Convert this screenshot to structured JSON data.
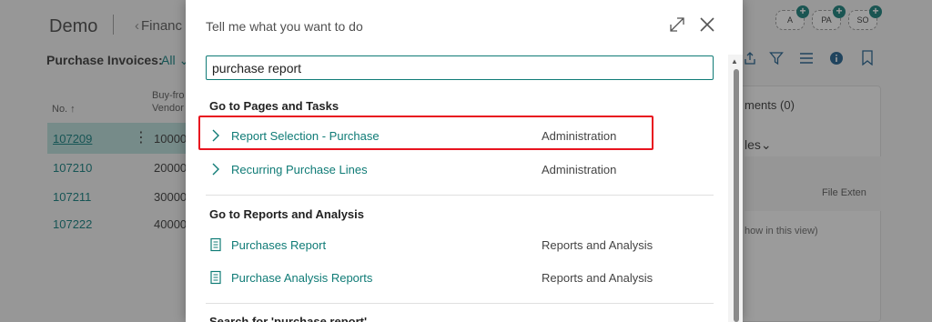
{
  "background": {
    "app_title": "Demo",
    "breadcrumb": "Financ",
    "list_title": "Purchase Invoices:",
    "filter": "All",
    "columns": {
      "no": "No. ↑",
      "vendor": "Buy-fro\nVendor"
    },
    "rows": [
      {
        "no": "107209",
        "vendor": "10000"
      },
      {
        "no": "107210",
        "vendor": "20000"
      },
      {
        "no": "107211",
        "vendor": "30000"
      },
      {
        "no": "107222",
        "vendor": "40000"
      }
    ],
    "badges": [
      "A",
      "PA",
      "SO"
    ],
    "factbox": {
      "title": "ments (0)",
      "subtitle": "les",
      "column": "File Exten",
      "note": "how in this view)"
    }
  },
  "dialog": {
    "title": "Tell me what you want to do",
    "search_value": "purchase report",
    "sections": [
      {
        "heading": "Go to Pages and Tasks",
        "items": [
          {
            "label": "Report Selection - Purchase",
            "category": "Administration",
            "icon": "chevron-right-icon"
          },
          {
            "label": "Recurring Purchase Lines",
            "category": "Administration",
            "icon": "chevron-right-icon"
          }
        ]
      },
      {
        "heading": "Go to Reports and Analysis",
        "items": [
          {
            "label": "Purchases Report",
            "category": "Reports and Analysis",
            "icon": "report-icon"
          },
          {
            "label": "Purchase Analysis Reports",
            "category": "Reports and Analysis",
            "icon": "report-icon"
          }
        ]
      }
    ],
    "more_heading": "Search for 'purchase report'"
  },
  "colors": {
    "accent": "#0f7b76",
    "highlight": "#e8131f"
  }
}
